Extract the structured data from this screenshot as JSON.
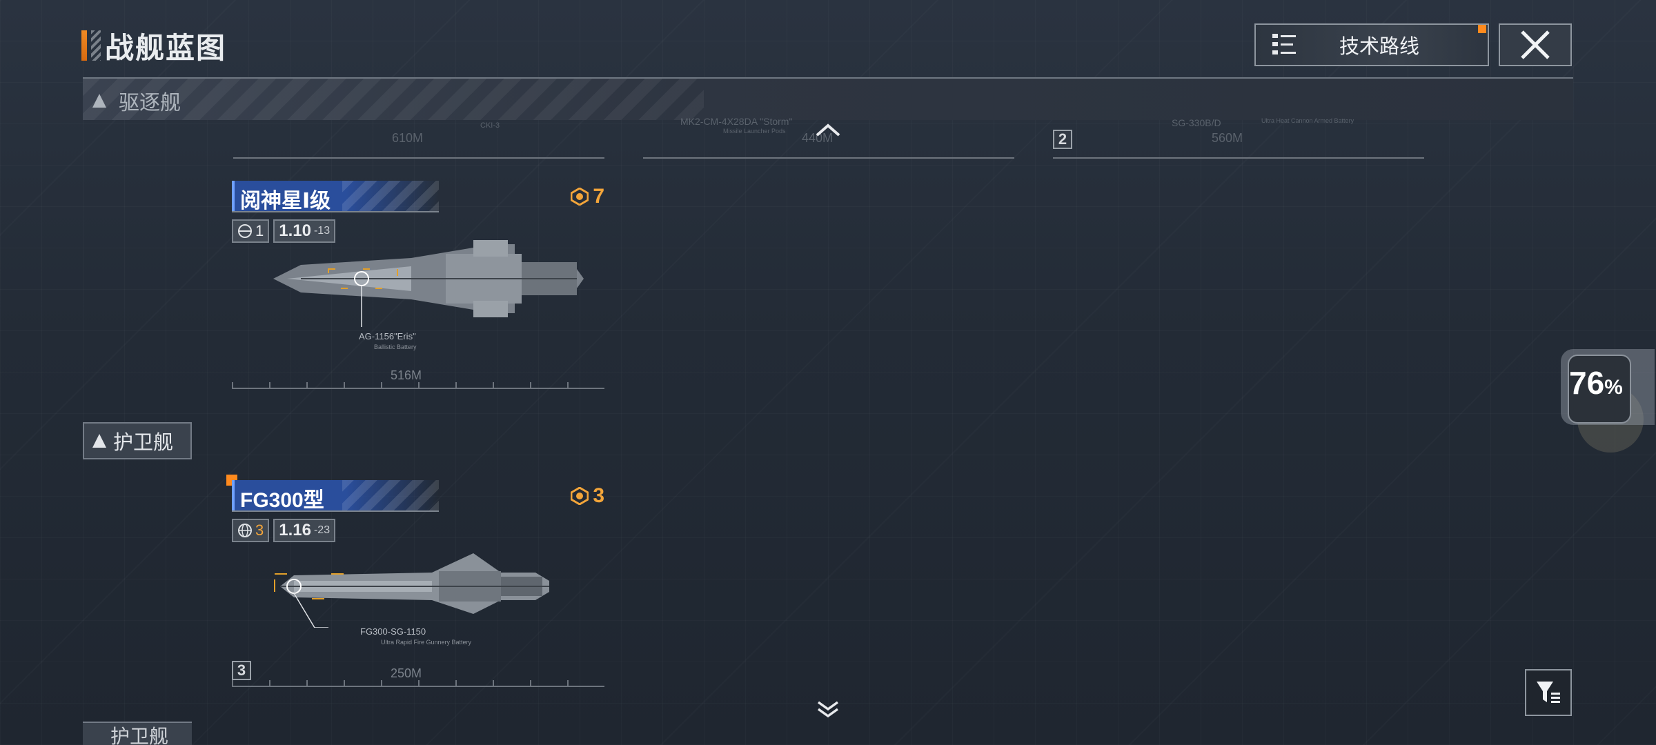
{
  "header": {
    "title": "战舰蓝图",
    "tech_route_label": "技术路线"
  },
  "categories": {
    "destroyer": "驱逐舰",
    "frigate": "护卫舰",
    "next_partial": "护卫舰"
  },
  "ships": [
    {
      "name": "阅神星Ⅰ级",
      "power": "7",
      "tier": "1",
      "version_main": "1.10",
      "version_sub": "-13",
      "weapon_name": "AG-1156\"Eris\"",
      "weapon_desc": "Ballistic Battery",
      "length": "516M"
    },
    {
      "name": "FG300型",
      "power": "3",
      "tier": "3",
      "version_main": "1.16",
      "version_sub": "-23",
      "weapon_name": "FG300-SG-1150",
      "weapon_desc": "Ultra Rapid Fire Gunnery Battery",
      "length": "250M",
      "badge": "3"
    }
  ],
  "top_row": {
    "left_length": "610M",
    "center_length": "440M",
    "center_weapon": "MK2-CM-4X28DA \"Storm\"",
    "center_weapon_desc": "Missile Launcher Pods",
    "right_length": "560M",
    "right_weapon": "SG-330B/D",
    "right_weapon_desc": "Ultra Heat Cannon Armed Battery",
    "right_badge": "2",
    "left_code": "CKI-3"
  },
  "performance": {
    "value": "76",
    "unit": "%"
  },
  "colors": {
    "accent_orange": "#ff8a1e",
    "power_gold": "#f3a53a",
    "name_blue": "#2a4e9c"
  },
  "icons": {
    "tech_route": "tech-tree-icon",
    "close": "close-icon",
    "filter": "filter-icon",
    "scroll_up": "chevron-up-icon",
    "scroll_down": "chevron-down-icon"
  }
}
